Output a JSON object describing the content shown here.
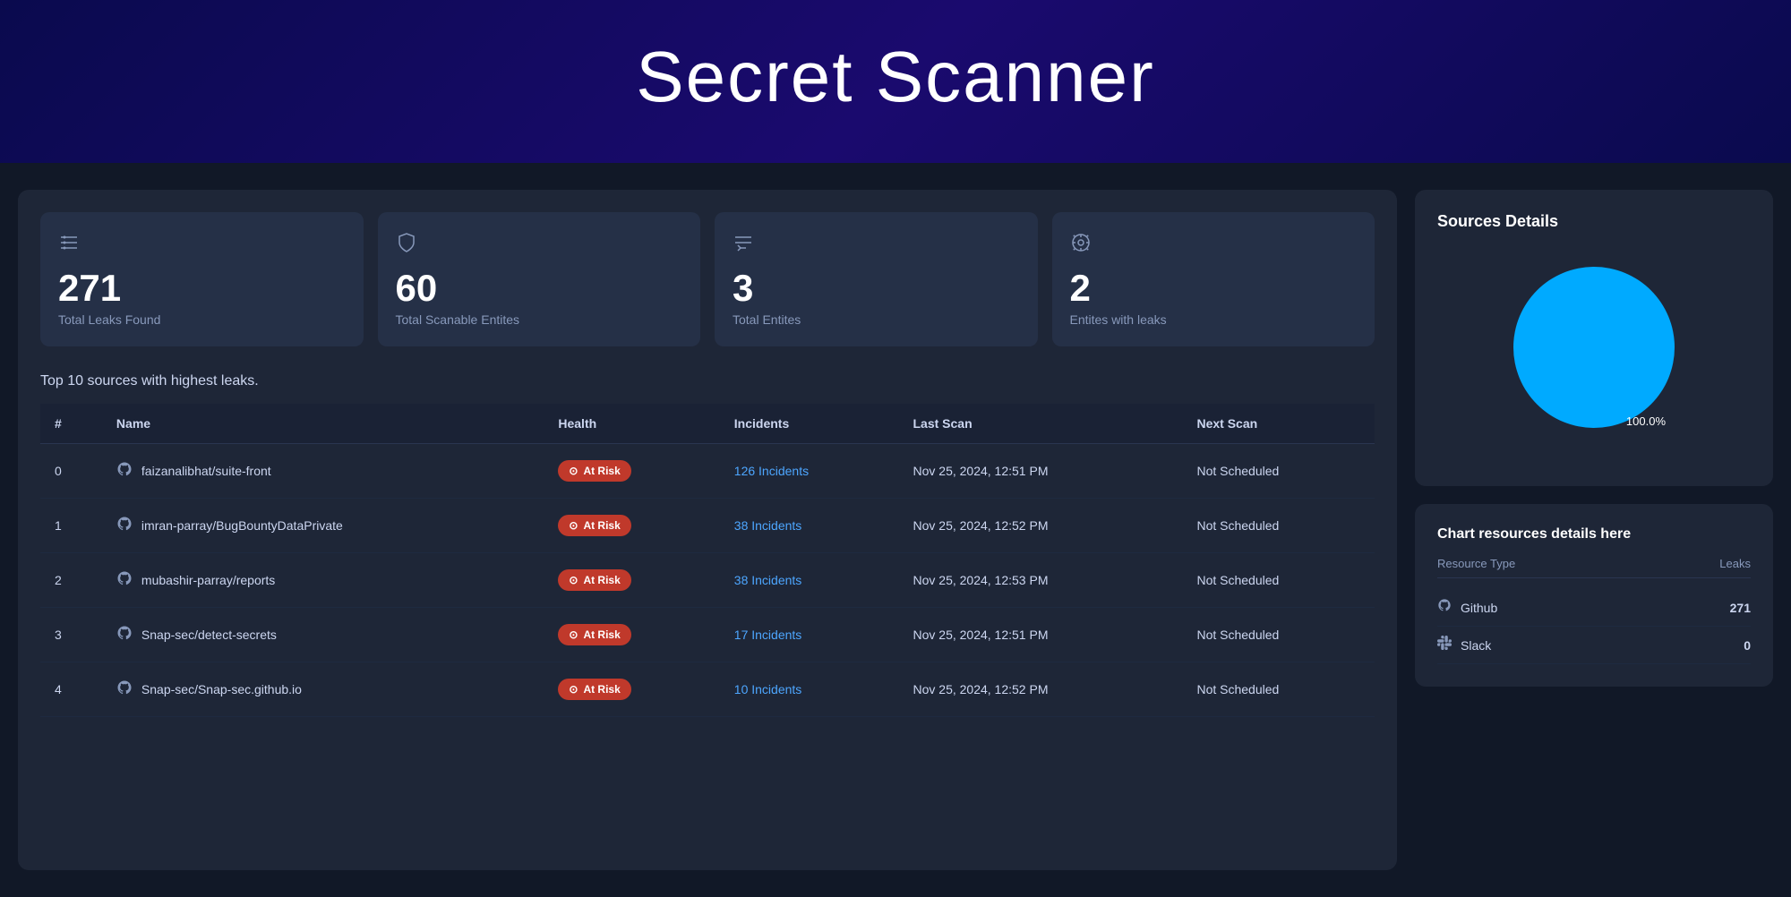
{
  "header": {
    "title": "Secret Scanner"
  },
  "stats": [
    {
      "icon": "≡•",
      "number": "271",
      "label": "Total Leaks Found"
    },
    {
      "icon": "⊙",
      "number": "60",
      "label": "Total Scanable Entites"
    },
    {
      "icon": "≡↑",
      "number": "3",
      "label": "Total Entites"
    },
    {
      "icon": "☣",
      "number": "2",
      "label": "Entites with leaks"
    }
  ],
  "table": {
    "section_title": "Top 10 sources with highest leaks.",
    "columns": [
      "#",
      "Name",
      "Health",
      "Incidents",
      "Last Scan",
      "Next Scan"
    ],
    "rows": [
      {
        "index": "0",
        "name": "faizanalibhat/suite-front",
        "health": "At Risk",
        "incidents": "126 Incidents",
        "last_scan": "Nov 25, 2024, 12:51 PM",
        "next_scan": "Not Scheduled"
      },
      {
        "index": "1",
        "name": "imran-parray/BugBountyDataPrivate",
        "health": "At Risk",
        "incidents": "38 Incidents",
        "last_scan": "Nov 25, 2024, 12:52 PM",
        "next_scan": "Not Scheduled"
      },
      {
        "index": "2",
        "name": "mubashir-parray/reports",
        "health": "At Risk",
        "incidents": "38 Incidents",
        "last_scan": "Nov 25, 2024, 12:53 PM",
        "next_scan": "Not Scheduled"
      },
      {
        "index": "3",
        "name": "Snap-sec/detect-secrets",
        "health": "At Risk",
        "incidents": "17 Incidents",
        "last_scan": "Nov 25, 2024, 12:51 PM",
        "next_scan": "Not Scheduled"
      },
      {
        "index": "4",
        "name": "Snap-sec/Snap-sec.github.io",
        "health": "At Risk",
        "incidents": "10 Incidents",
        "last_scan": "Nov 25, 2024, 12:52 PM",
        "next_scan": "Not Scheduled"
      }
    ]
  },
  "sources_details": {
    "title": "Sources Details",
    "pie_label": "100.0%",
    "chart_title": "Chart resources details here",
    "resource_header_type": "Resource Type",
    "resource_header_leaks": "Leaks",
    "resources": [
      {
        "icon": "github",
        "name": "Github",
        "leaks": "271"
      },
      {
        "icon": "slack",
        "name": "Slack",
        "leaks": "0"
      }
    ]
  }
}
